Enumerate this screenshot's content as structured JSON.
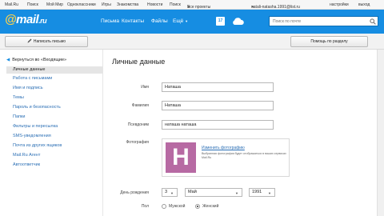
{
  "portal": {
    "items": [
      {
        "label": "Mail.Ru"
      },
      {
        "label": "Поиск"
      },
      {
        "label": "Мой Мир"
      },
      {
        "label": "Одноклассники"
      },
      {
        "label": "Игры"
      },
      {
        "label": "Знакомства"
      },
      {
        "label": "Новости"
      },
      {
        "label": "Поиск"
      },
      {
        "label": "Все проекты"
      }
    ],
    "user_email": "natali-natasha.1991@list.ru",
    "settings": "настройки",
    "logout": "выход"
  },
  "header": {
    "logo_text": "mail",
    "logo_suffix": ".ru",
    "nav": [
      {
        "label": "Письма"
      },
      {
        "label": "Контакты"
      },
      {
        "label": "Файлы"
      },
      {
        "label": "Ещё"
      }
    ],
    "calendar_day": "17",
    "search_placeholder": "Поиск по почте"
  },
  "toolbar": {
    "compose_label": "Написать письмо",
    "help_label": "Помощь по разделу"
  },
  "sidebar": {
    "back_label": "Вернуться во «Входящие»",
    "items": [
      {
        "label": "Личные данные"
      },
      {
        "label": "Работа с письмами"
      },
      {
        "label": "Имя и подпись"
      },
      {
        "label": "Темы"
      },
      {
        "label": "Пароль и безопасность"
      },
      {
        "label": "Папки"
      },
      {
        "label": "Фильтры и пересылка"
      },
      {
        "label": "SMS-уведомления"
      },
      {
        "label": "Почта из других ящиков"
      },
      {
        "label": "Mail.Ru Агент"
      },
      {
        "label": "Автоответчик"
      }
    ]
  },
  "form": {
    "title": "Личные данные",
    "first_name_label": "Имя",
    "first_name_value": "Наташа",
    "last_name_label": "Фамилия",
    "last_name_value": "Наташа",
    "nickname_label": "Псевдоним",
    "nickname_value": "наташа наташа",
    "photo_label": "Фотография",
    "avatar_letter": "Н",
    "change_photo": "Изменить фотографию",
    "photo_hint": "Выбранная фотография будет отображаться в ваших сервисах Mail.Ru",
    "birthday_label": "День рождения",
    "birth_day": "3",
    "birth_month": "Май",
    "birth_year": "1991",
    "gender_label": "Пол",
    "gender_male": "Мужской",
    "gender_female": "Женский"
  },
  "colors": {
    "header_bg": "#168de2",
    "link": "#2b6fb5",
    "avatar_bg": "#b76aa3"
  }
}
